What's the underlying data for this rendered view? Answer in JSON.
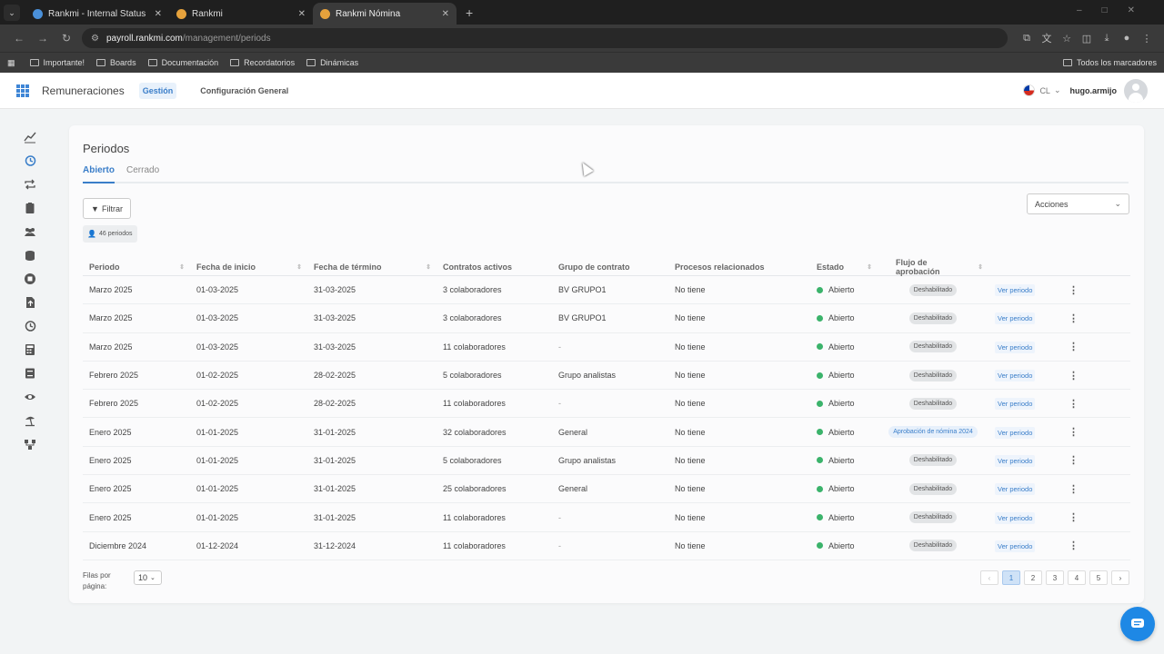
{
  "browser": {
    "tabs": [
      {
        "title": "Rankmi - Internal Status",
        "favicon_color": "#4a90d9"
      },
      {
        "title": "Rankmi",
        "favicon_color": "#e6a23c"
      },
      {
        "title": "Rankmi Nómina",
        "favicon_color": "#e6a23c"
      }
    ],
    "url_host": "payroll.rankmi.com",
    "url_path": "/management/periods",
    "bookmarks": [
      "Importante!",
      "Boards",
      "Documentación",
      "Recordatorios",
      "Dinámicas"
    ],
    "bookmarks_right": "Todos los marcadores"
  },
  "header": {
    "app_name": "Remuneraciones",
    "nav_active": "Gestión",
    "nav_config": "Configuración General",
    "country": "CL",
    "username": "hugo.armijo"
  },
  "sidebar": {
    "icons": [
      "chart-icon",
      "history-icon",
      "transfer-icon",
      "clipboard-icon",
      "users-icon",
      "coins-icon",
      "stop-icon",
      "upload-icon",
      "history2-icon",
      "calculator-icon",
      "book-icon",
      "eye-icon",
      "beach-icon",
      "workflow-icon"
    ]
  },
  "page": {
    "title": "Periodos",
    "tabs": [
      "Abierto",
      "Cerrado"
    ],
    "filter_label": "Filtrar",
    "count_label": "46 periodos",
    "actions_label": "Acciones"
  },
  "table": {
    "headers": [
      "Periodo",
      "Fecha de inicio",
      "Fecha de término",
      "Contratos activos",
      "Grupo de contrato",
      "Procesos relacionados",
      "Estado",
      "Flujo de aprobación"
    ],
    "rows": [
      {
        "periodo": "Marzo 2025",
        "inicio": "01-03-2025",
        "termino": "31-03-2025",
        "contratos": "3 colaboradores",
        "grupo": "BV GRUPO1",
        "procesos": "No tiene",
        "estado": "Abierto",
        "flujo": "Deshabilitado",
        "accion": "Ver periodo"
      },
      {
        "periodo": "Marzo 2025",
        "inicio": "01-03-2025",
        "termino": "31-03-2025",
        "contratos": "3 colaboradores",
        "grupo": "BV GRUPO1",
        "procesos": "No tiene",
        "estado": "Abierto",
        "flujo": "Deshabilitado",
        "accion": "Ver periodo"
      },
      {
        "periodo": "Marzo 2025",
        "inicio": "01-03-2025",
        "termino": "31-03-2025",
        "contratos": "11 colaboradores",
        "grupo": "-",
        "procesos": "No tiene",
        "estado": "Abierto",
        "flujo": "Deshabilitado",
        "accion": "Ver periodo"
      },
      {
        "periodo": "Febrero 2025",
        "inicio": "01-02-2025",
        "termino": "28-02-2025",
        "contratos": "5 colaboradores",
        "grupo": "Grupo analistas",
        "procesos": "No tiene",
        "estado": "Abierto",
        "flujo": "Deshabilitado",
        "accion": "Ver periodo"
      },
      {
        "periodo": "Febrero 2025",
        "inicio": "01-02-2025",
        "termino": "28-02-2025",
        "contratos": "11 colaboradores",
        "grupo": "-",
        "procesos": "No tiene",
        "estado": "Abierto",
        "flujo": "Deshabilitado",
        "accion": "Ver periodo"
      },
      {
        "periodo": "Enero 2025",
        "inicio": "01-01-2025",
        "termino": "31-01-2025",
        "contratos": "32 colaboradores",
        "grupo": "General",
        "procesos": "No tiene",
        "estado": "Abierto",
        "flujo": "Aprobación de nómina 2024",
        "accion": "Ver periodo"
      },
      {
        "periodo": "Enero 2025",
        "inicio": "01-01-2025",
        "termino": "31-01-2025",
        "contratos": "5 colaboradores",
        "grupo": "Grupo analistas",
        "procesos": "No tiene",
        "estado": "Abierto",
        "flujo": "Deshabilitado",
        "accion": "Ver periodo"
      },
      {
        "periodo": "Enero 2025",
        "inicio": "01-01-2025",
        "termino": "31-01-2025",
        "contratos": "25 colaboradores",
        "grupo": "General",
        "procesos": "No tiene",
        "estado": "Abierto",
        "flujo": "Deshabilitado",
        "accion": "Ver periodo"
      },
      {
        "periodo": "Enero 2025",
        "inicio": "01-01-2025",
        "termino": "31-01-2025",
        "contratos": "11 colaboradores",
        "grupo": "-",
        "procesos": "No tiene",
        "estado": "Abierto",
        "flujo": "Deshabilitado",
        "accion": "Ver periodo"
      },
      {
        "periodo": "Diciembre 2024",
        "inicio": "01-12-2024",
        "termino": "31-12-2024",
        "contratos": "11 colaboradores",
        "grupo": "-",
        "procesos": "No tiene",
        "estado": "Abierto",
        "flujo": "Deshabilitado",
        "accion": "Ver periodo"
      }
    ]
  },
  "footer": {
    "rows_per_page_label": "Filas por página:",
    "rows_per_page": "10",
    "pages": [
      "1",
      "2",
      "3",
      "4",
      "5"
    ],
    "current_page": "1"
  },
  "colors": {
    "accent": "#3a7ec9",
    "status_open": "#3bb36b"
  }
}
